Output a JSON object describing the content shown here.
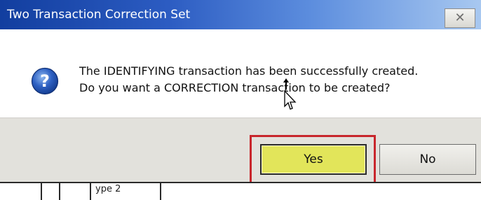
{
  "dialog": {
    "title": "Two Transaction Correction Set",
    "close_icon": "close-icon",
    "message_icon": "question-icon",
    "message_line_1": "The IDENTIFYING transaction has been successfully created.",
    "message_line_2": "Do you want a CORRECTION transaction to be created?",
    "buttons": {
      "yes_label": "Yes",
      "no_label": "No"
    }
  },
  "background": {
    "cell_text": "ype 2"
  },
  "colors": {
    "titlebar_start": "#123e9f",
    "titlebar_end": "#a8c8f0",
    "yes_highlight": "#e2e55a",
    "annotation_border": "#c8262c"
  }
}
